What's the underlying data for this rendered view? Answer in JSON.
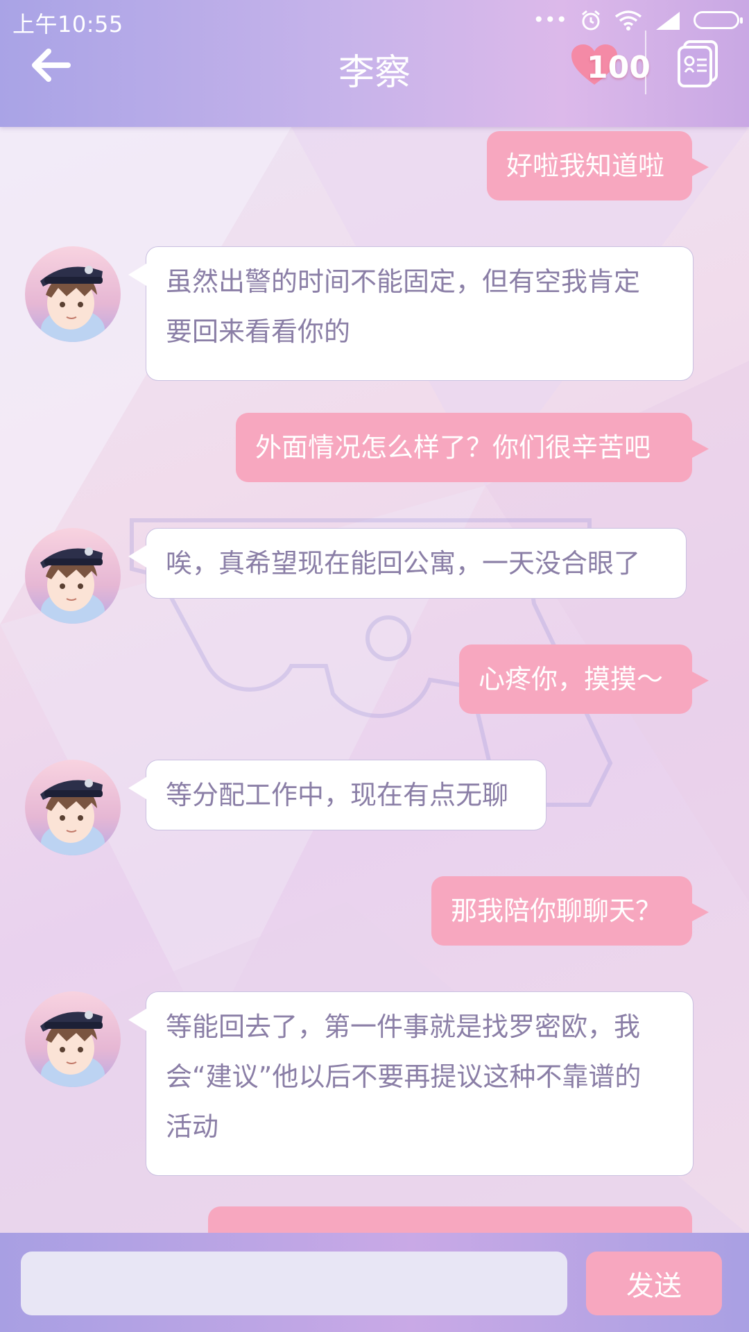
{
  "status_bar": {
    "time": "上午10:55"
  },
  "header": {
    "title": "李察",
    "affection": "100"
  },
  "messages": [
    {
      "side": "out",
      "text": "好啦我知道啦"
    },
    {
      "side": "in",
      "line1": "虽然出警的时间不能固定，但有空我肯定",
      "line2": "要回来看看你的"
    },
    {
      "side": "out",
      "text": "外面情况怎么样了？你们很辛苦吧"
    },
    {
      "side": "in",
      "text": "唉，真希望现在能回公寓，一天没合眼了"
    },
    {
      "side": "out",
      "text": "心疼你，摸摸～"
    },
    {
      "side": "in",
      "text": "等分配工作中，现在有点无聊"
    },
    {
      "side": "out",
      "text": "那我陪你聊聊天？"
    },
    {
      "side": "in",
      "line1": "等能回去了，第一件事就是找罗密欧，我",
      "line2": "会“建议”他以后不要再提议这种不靠谱的",
      "line3": "活动"
    }
  ],
  "composer": {
    "input_value": "",
    "send_label": "发送"
  },
  "colors": {
    "accent_pink": "#f7a7bf",
    "header_purple": "#b9ade9",
    "incoming_text": "#8a7ea6"
  },
  "icons": [
    "back-arrow-icon",
    "heart-icon",
    "contact-card-icon",
    "alarm-icon",
    "wifi-icon",
    "signal-icon",
    "battery-icon"
  ]
}
